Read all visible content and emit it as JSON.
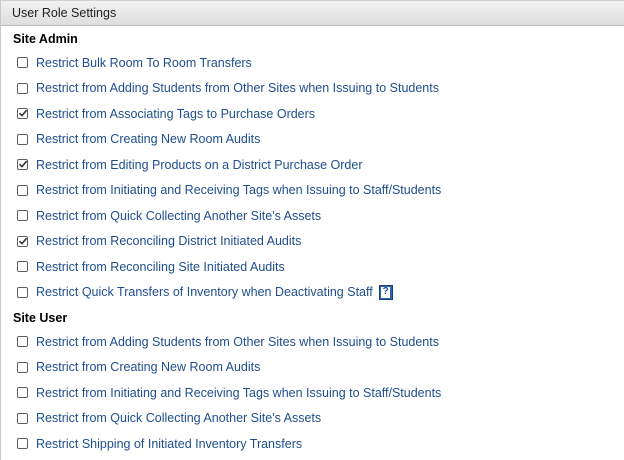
{
  "header": {
    "title": "User Role Settings"
  },
  "sections": [
    {
      "title": "Site Admin",
      "options": [
        {
          "label": "Restrict Bulk Room To Room Transfers",
          "checked": false
        },
        {
          "label": "Restrict from Adding Students from Other Sites when Issuing to Students",
          "checked": false
        },
        {
          "label": "Restrict from Associating Tags to Purchase Orders",
          "checked": true
        },
        {
          "label": "Restrict from Creating New Room Audits",
          "checked": false
        },
        {
          "label": "Restrict from Editing Products on a District Purchase Order",
          "checked": true
        },
        {
          "label": "Restrict from Initiating and Receiving Tags when Issuing to Staff/Students",
          "checked": false
        },
        {
          "label": "Restrict from Quick Collecting Another Site's Assets",
          "checked": false
        },
        {
          "label": "Restrict from Reconciling District Initiated Audits",
          "checked": true
        },
        {
          "label": "Restrict from Reconciling Site Initiated Audits",
          "checked": false
        },
        {
          "label": "Restrict Quick Transfers of Inventory when Deactivating Staff",
          "checked": false,
          "help_icon": "?"
        }
      ]
    },
    {
      "title": "Site User",
      "options": [
        {
          "label": "Restrict from Adding Students from Other Sites when Issuing to Students",
          "checked": false
        },
        {
          "label": "Restrict from Creating New Room Audits",
          "checked": false
        },
        {
          "label": "Restrict from Initiating and Receiving Tags when Issuing to Staff/Students",
          "checked": false
        },
        {
          "label": "Restrict from Quick Collecting Another Site's Assets",
          "checked": false
        },
        {
          "label": "Restrict Shipping of Initiated Inventory Transfers",
          "checked": false
        }
      ]
    }
  ],
  "colors": {
    "label": "#1f4e8f",
    "help_icon": "#2f64b5"
  }
}
